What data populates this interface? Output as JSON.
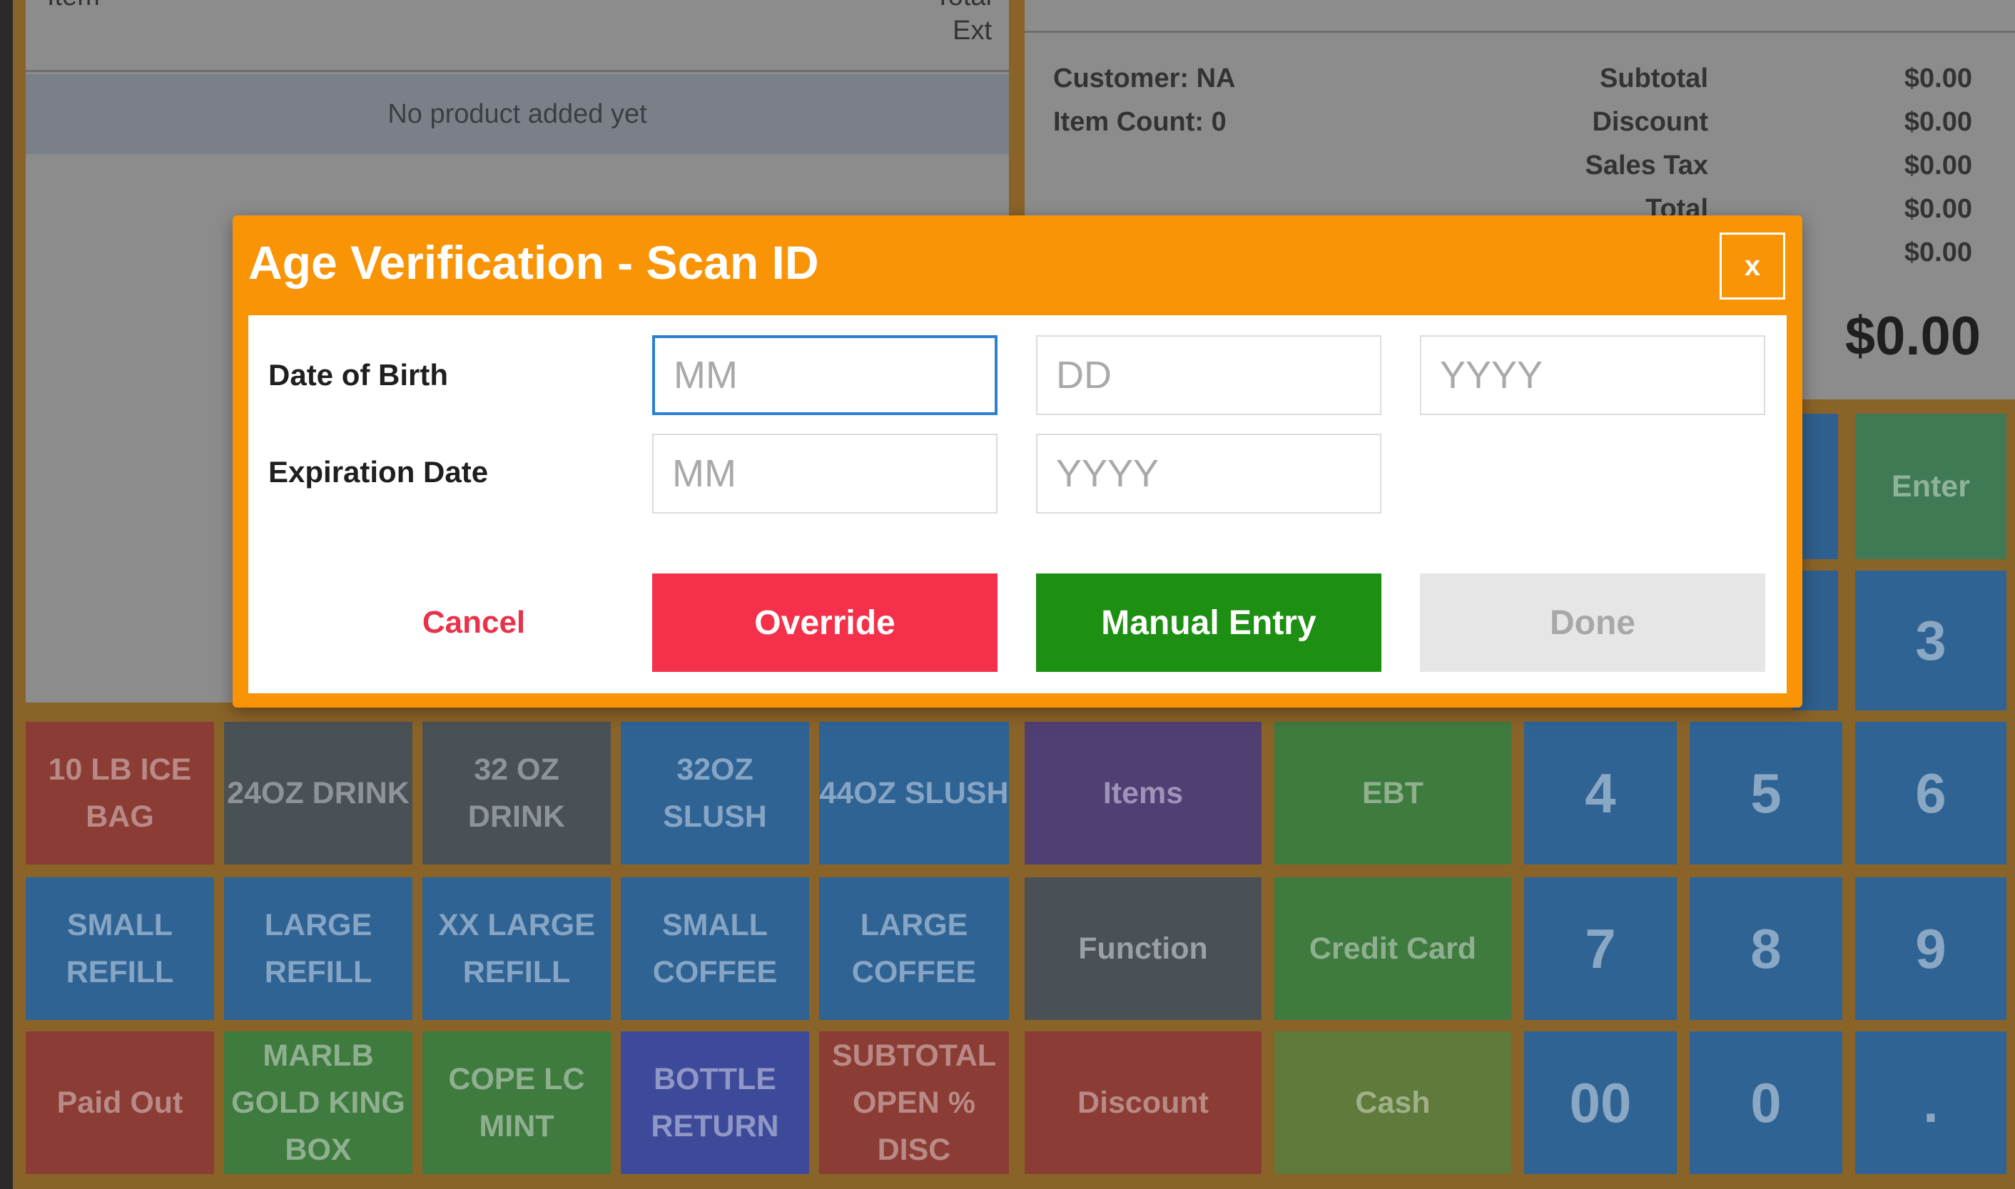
{
  "cart": {
    "col_item": "Item",
    "col_total": "Total",
    "col_ext": "Ext",
    "empty_message": "No product added yet"
  },
  "summary": {
    "customer": "Customer: NA",
    "item_count": "Item Count: 0",
    "labels": [
      "Subtotal",
      "Discount",
      "Sales Tax",
      "Total"
    ],
    "values": [
      "$0.00",
      "$0.00",
      "$0.00",
      "$0.00",
      "$0.00"
    ],
    "grand_total": "$0.00"
  },
  "keys": {
    "row1": [
      "10 LB ICE BAG",
      "24OZ DRINK",
      "32 OZ DRINK",
      "32OZ SLUSH",
      "44OZ SLUSH"
    ],
    "row2": [
      "SMALL REFILL",
      "LARGE REFILL",
      "XX LARGE REFILL",
      "SMALL COFFEE",
      "LARGE COFFEE"
    ],
    "row3": [
      "Paid Out",
      "MARLB GOLD KING BOX",
      "COPE LC MINT",
      "BOTTLE RETURN",
      "SUBTOTAL OPEN % DISC"
    ],
    "functions": [
      "Items",
      "Function",
      "Discount"
    ],
    "payments": [
      "EBT",
      "Credit Card",
      "Cash"
    ],
    "enter": "Enter",
    "numpad": [
      "3",
      "4",
      "5",
      "6",
      "7",
      "8",
      "9",
      "00",
      "0",
      "."
    ]
  },
  "modal": {
    "title": "Age Verification - Scan ID",
    "close_label": "x",
    "dob_label": "Date of Birth",
    "exp_label": "Expiration Date",
    "dob_mm_placeholder": "MM",
    "dob_dd_placeholder": "DD",
    "dob_yyyy_placeholder": "YYYY",
    "exp_mm_placeholder": "MM",
    "exp_yyyy_placeholder": "YYYY",
    "cancel_label": "Cancel",
    "override_label": "Override",
    "manual_entry_label": "Manual Entry",
    "done_label": "Done"
  },
  "colors": {
    "modal_header": "#f89406",
    "override": "#f5304a",
    "manual_entry": "#1d8f13",
    "cancel_text": "#e8334a",
    "focus_border": "#2c7fd3"
  }
}
